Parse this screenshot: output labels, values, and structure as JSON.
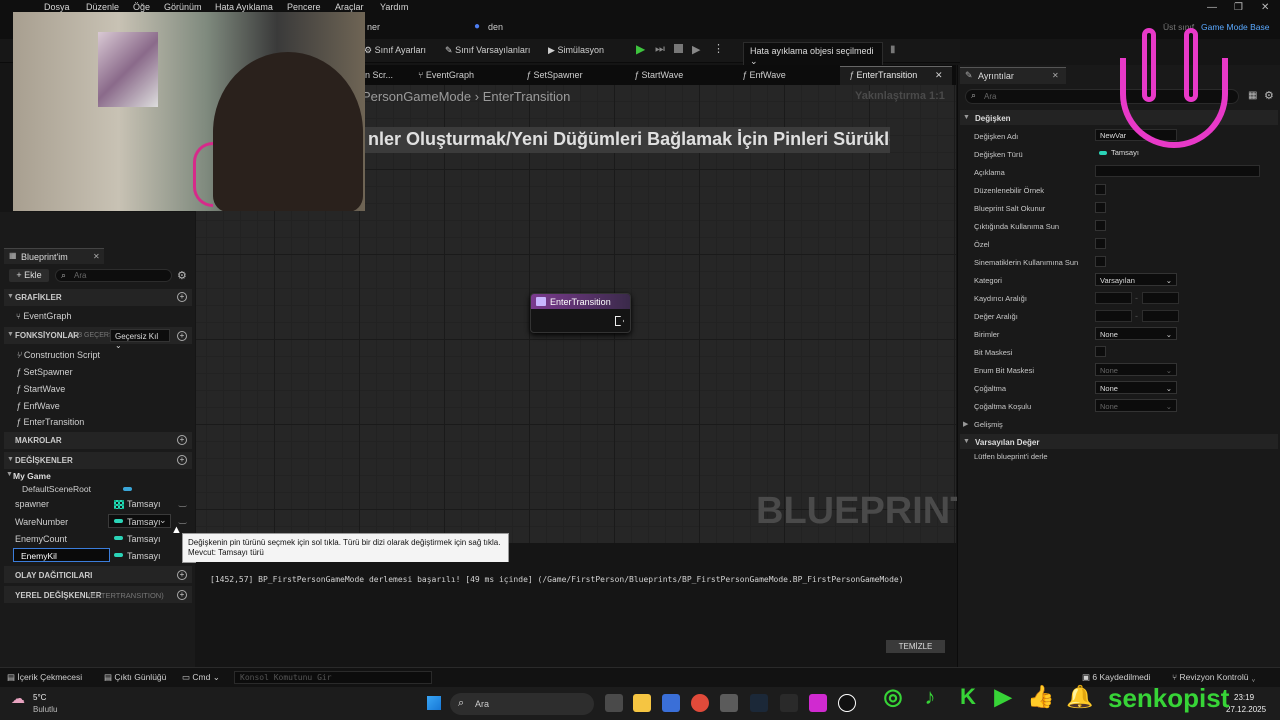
{
  "menu": [
    "Dosya",
    "Düzenle",
    "Öğe",
    "Görünüm",
    "Hata Ayıklama",
    "Pencere",
    "Araçlar",
    "Yardım"
  ],
  "title_row": {
    "partial": "ner",
    "user": "den",
    "parent_label": "Üst sınıf",
    "parent_value": "Game Mode Base"
  },
  "toolbar": {
    "class_settings": "Sınıf Ayarları",
    "class_defaults": "Sınıf Varsayılanları",
    "simulation": "Simülasyon",
    "debug_dropdown": "Hata ayıklama objesi seçilmedi"
  },
  "tabs": [
    "on Scr...",
    "EventGraph",
    "SetSpawner",
    "StartWave",
    "EnfWave",
    "EnterTransition"
  ],
  "graph": {
    "breadcrumb_class": "PersonGameMode",
    "breadcrumb_sep": "›",
    "breadcrumb_func": "EnterTransition",
    "zoom": "Yakınlaştırma 1:1",
    "hint": "nler Oluşturmak/Yeni Düğümleri Bağlamak İçin Pinleri Sürükle",
    "watermark": "BLUEPRINT",
    "node_title": "EnterTransition"
  },
  "my_blueprint": {
    "tab": "Blueprint'im",
    "add": "+ Ekle",
    "search_placeholder": "Ara",
    "sections": {
      "graphs": "GRAFİKLER",
      "functions": "FONKSİYONLAR",
      "functions_count": "(33 GEÇERSİ",
      "override": "Geçersiz Kıl",
      "macros": "MAKROLAR",
      "variables": "DEĞİŞKENLER",
      "dispatchers": "OLAY DAĞITICILARI",
      "local_vars": "YEREL DEĞİŞKENLER",
      "local_vars_scope": "(ENTERTRANSITION)"
    },
    "graph_items": [
      "EventGraph"
    ],
    "functions": [
      "Construction Script",
      "SetSpawner",
      "StartWave",
      "EnfWave",
      "EnterTransition"
    ],
    "var_category": "My Game",
    "variables": [
      {
        "name": "DefaultSceneRoot",
        "type": ""
      },
      {
        "name": "spawner",
        "type": "Tamsayı"
      },
      {
        "name": "WareNumber",
        "type": "Tamsayı"
      },
      {
        "name": "EnemyCount",
        "type": "Tamsayı"
      },
      {
        "name": "EnemyKil",
        "type": "Tamsayı"
      }
    ]
  },
  "tooltip": {
    "line1": "Değişkenin pin türünü seçmek için sol tıkla. Türü bir dizi olarak değiştirmek için sağ tıkla.",
    "line2": "Mevcut: Tamsayı türü"
  },
  "output": {
    "log": "[1452,57] BP_FirstPersonGameMode derlemesi başarılı! [49 ms içinde] (/Game/FirstPerson/Blueprints/BP_FirstPersonGameMode.BP_FirstPersonGameMode)",
    "clear": "TEMİZLE"
  },
  "details": {
    "tab": "Ayrıntılar",
    "search_placeholder": "Ara",
    "section_variable": "Değişken",
    "rows": [
      {
        "label": "Değişken Adı",
        "value": "NewVar"
      },
      {
        "label": "Değişken Türü",
        "value": "Tamsayı"
      },
      {
        "label": "Açıklama",
        "value": ""
      },
      {
        "label": "Düzenlenebilir Örnek",
        "value": ""
      },
      {
        "label": "Blueprint Salt Okunur",
        "value": ""
      },
      {
        "label": "Çıktığında Kullanıma Sun",
        "value": ""
      },
      {
        "label": "Özel",
        "value": ""
      },
      {
        "label": "Sinematiklerin Kullanımına Sun",
        "value": ""
      },
      {
        "label": "Kategori",
        "value": "Varsayılan"
      },
      {
        "label": "Kaydırıcı Aralığı",
        "value": ""
      },
      {
        "label": "Değer Aralığı",
        "value": ""
      },
      {
        "label": "Birimler",
        "value": "None"
      },
      {
        "label": "Bit Maskesi",
        "value": ""
      },
      {
        "label": "Enum Bit Maskesi",
        "value": "None"
      },
      {
        "label": "Çoğaltma",
        "value": "None"
      },
      {
        "label": "Çoğaltma Koşulu",
        "value": "None"
      }
    ],
    "advanced": "Gelişmiş",
    "section_default": "Varsayılan Değer",
    "default_msg": "Lütfen blueprint'i derle"
  },
  "statusbar": {
    "content_drawer": "İçerik Çekmecesi",
    "output_log": "Çıktı Günlüğü",
    "cmd": "Cmd",
    "console_placeholder": "Konsol Komutunu Gir",
    "unsaved": "6 Kaydedilmedi",
    "revision": "Revizyon Kontrolü"
  },
  "taskbar": {
    "temp": "5°C",
    "weather": "Bulutlu",
    "search": "Ara",
    "time": "23:19",
    "date": "27.12.2025"
  },
  "overlay": {
    "brand": "senkopist"
  }
}
